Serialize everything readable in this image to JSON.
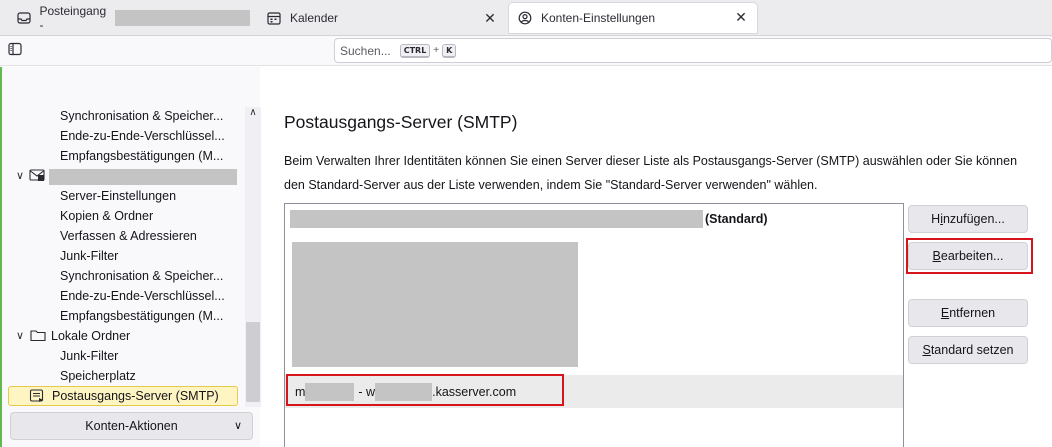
{
  "tabs": [
    {
      "label": "Posteingang -",
      "icon": "inbox-icon",
      "active": false
    },
    {
      "label": "Kalender",
      "icon": "calendar-icon",
      "active": false
    },
    {
      "label": "Konten-Einstellungen",
      "icon": "account-settings-icon",
      "active": true
    }
  ],
  "toolbar": {
    "search_placeholder": "Suchen...",
    "shortcut_key1": "CTRL",
    "shortcut_plus": "+",
    "shortcut_key2": "K"
  },
  "sidebar": {
    "items_account1": [
      "Synchronisation & Speicher...",
      "Ende-zu-Ende-Verschlüssel...",
      "Empfangsbestätigungen (M..."
    ],
    "items_account2": [
      "Server-Einstellungen",
      "Kopien & Ordner",
      "Verfassen & Adressieren",
      "Junk-Filter",
      "Synchronisation & Speicher...",
      "Ende-zu-Ende-Verschlüssel...",
      "Empfangsbestätigungen (M..."
    ],
    "local_folders_label": "Lokale Ordner",
    "local_items": [
      "Junk-Filter",
      "Speicherplatz"
    ],
    "smtp_label": "Postausgangs-Server (SMTP)",
    "account_actions_label": "Konten-Aktionen"
  },
  "main": {
    "title": "Postausgangs-Server (SMTP)",
    "description": "Beim Verwalten Ihrer Identitäten können Sie einen Server dieser Liste als Postausgangs-Server (SMTP) auswählen oder Sie können den Standard-Server aus der Liste verwenden, indem Sie \"Standard-Server verwenden\" wählen.",
    "servers": {
      "default_suffix": "(Standard)",
      "row3_prefix": "m",
      "row3_sep": "- w",
      "row3_domain": ".kasserver.com"
    },
    "buttons": {
      "add": {
        "pre": "H",
        "key": "i",
        "post": "nzufügen..."
      },
      "edit": {
        "pre": "",
        "key": "B",
        "post": "earbeiten..."
      },
      "remove": {
        "pre": "",
        "key": "E",
        "post": "ntfernen"
      },
      "set_default": {
        "pre": "",
        "key": "S",
        "post": "tandard setzen"
      }
    }
  },
  "colors": {
    "highlight": "#d7141a",
    "selected_row_bg": "#ebebeb",
    "sidebar_selected_bg": "#fff5c2"
  }
}
